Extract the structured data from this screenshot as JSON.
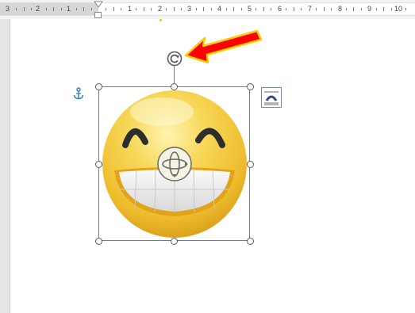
{
  "ruler": {
    "left_numbers": [
      "3",
      "2",
      "1"
    ],
    "right_numbers": [
      "1",
      "2",
      "3",
      "4",
      "5",
      "6",
      "7",
      "8",
      "9",
      "10"
    ]
  },
  "icons": {
    "anchor": "anchor-icon",
    "rotate": "rotate-handle-icon",
    "move": "move-handle-icon",
    "layout": "layout-options-icon",
    "arrow": "red-arrow-annotation"
  },
  "colors": {
    "arrow_fill": "#ff0000",
    "arrow_outline": "#f4d000",
    "anchor": "#2b7bd0",
    "emoji_face": "#f4c63a"
  }
}
